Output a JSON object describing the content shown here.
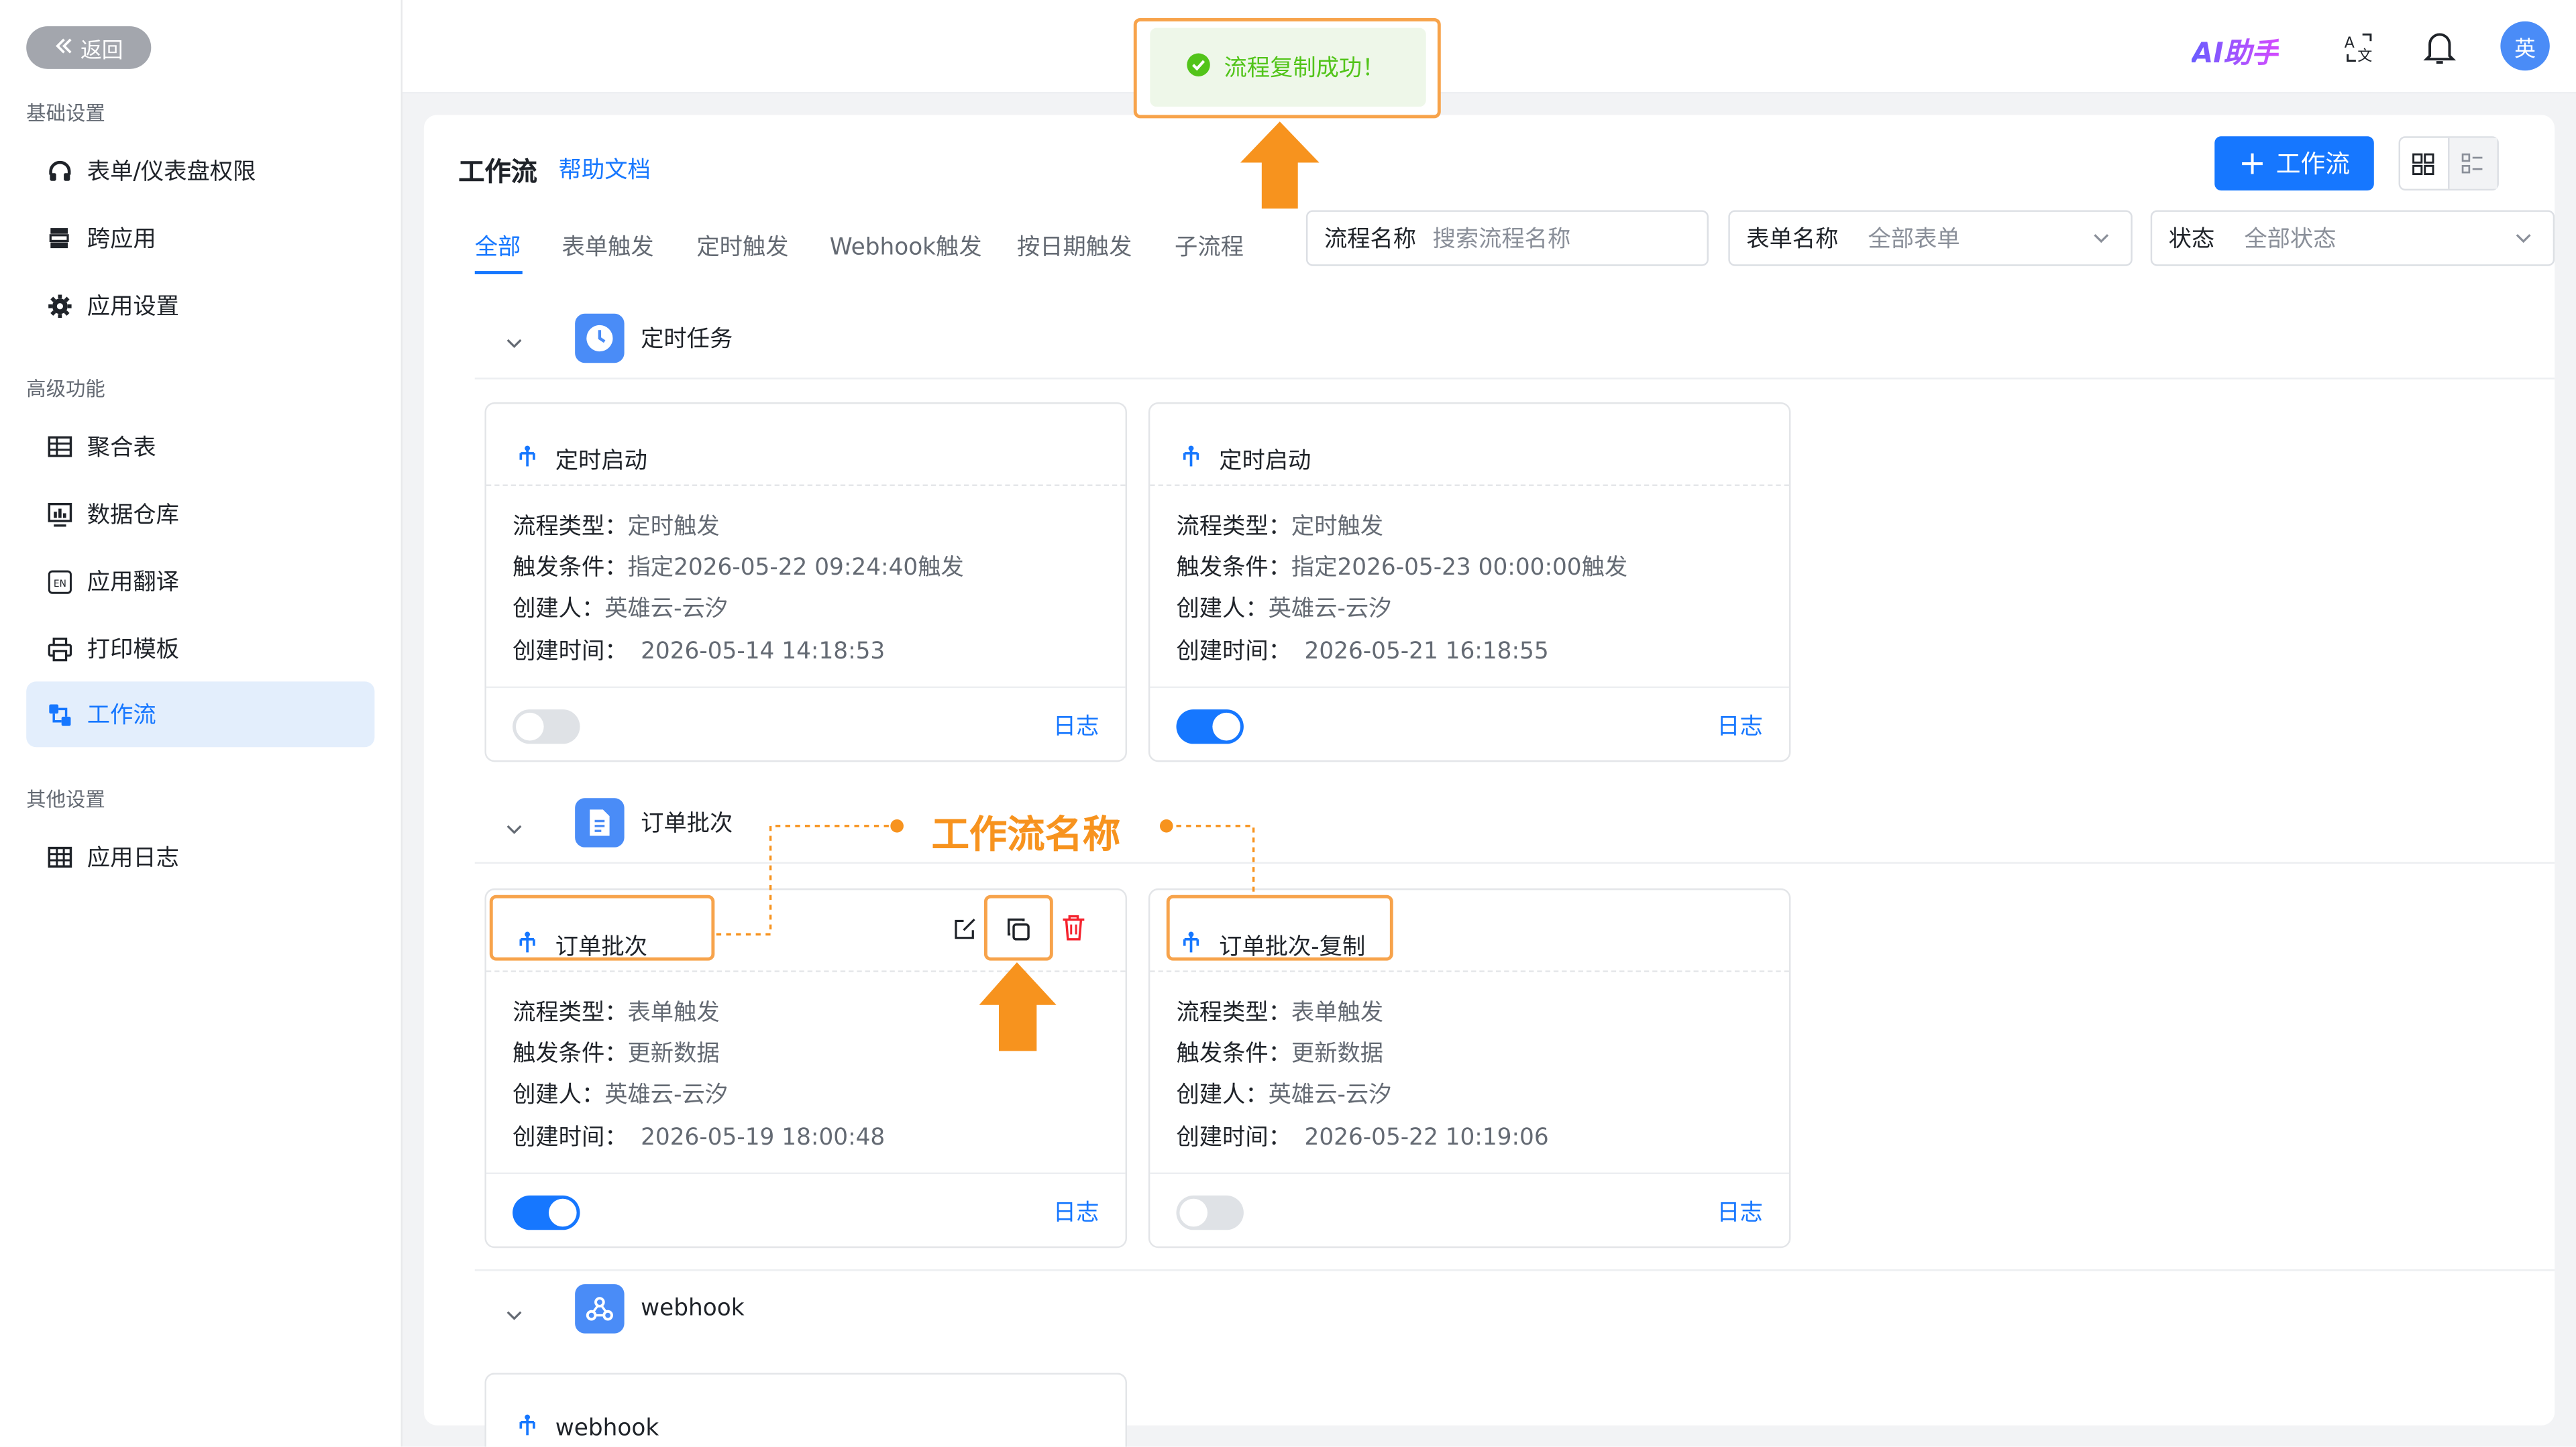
{
  "sidebar": {
    "back_label": "返回",
    "sections": [
      {
        "title": "基础设置",
        "items": [
          {
            "label": "表单/仪表盘权限",
            "icon": "headset-icon"
          },
          {
            "label": "跨应用",
            "icon": "stack-icon"
          },
          {
            "label": "应用设置",
            "icon": "gear-icon"
          }
        ]
      },
      {
        "title": "高级功能",
        "items": [
          {
            "label": "聚合表",
            "icon": "table-icon"
          },
          {
            "label": "数据仓库",
            "icon": "chart-icon"
          },
          {
            "label": "应用翻译",
            "icon": "translate-icon"
          },
          {
            "label": "打印模板",
            "icon": "printer-icon"
          },
          {
            "label": "工作流",
            "icon": "workflow-icon",
            "active": true
          }
        ]
      },
      {
        "title": "其他设置",
        "items": [
          {
            "label": "应用日志",
            "icon": "log-icon"
          }
        ]
      }
    ]
  },
  "header": {
    "ai_label": "AI助手",
    "avatar_text": "英"
  },
  "toast": {
    "message": "流程复制成功！"
  },
  "page": {
    "title": "工作流",
    "help_link": "帮助文档",
    "add_button": "工作流",
    "tabs": [
      "全部",
      "表单触发",
      "定时触发",
      "Webhook触发",
      "按日期触发",
      "子流程"
    ],
    "active_tab": 0,
    "filters": {
      "flow_name_label": "流程名称",
      "flow_name_placeholder": "搜索流程名称",
      "form_name_label": "表单名称",
      "form_name_value": "全部表单",
      "status_label": "状态",
      "status_value": "全部状态"
    }
  },
  "field_labels": {
    "type": "流程类型：",
    "trigger": "触发条件：",
    "creator": "创建人：",
    "created": "创建时间："
  },
  "log_label": "日志",
  "groups": [
    {
      "name": "定时任务",
      "icon": "clock-icon",
      "cards": [
        {
          "title": "定时启动",
          "type": "定时触发",
          "trigger": "指定2026-05-22 09:24:40触发",
          "creator": "英雄云-云汐",
          "created": "2026-05-14 14:18:53",
          "enabled": false
        },
        {
          "title": "定时启动",
          "type": "定时触发",
          "trigger": "指定2026-05-23 00:00:00触发",
          "creator": "英雄云-云汐",
          "created": "2026-05-21 16:18:55",
          "enabled": true
        }
      ]
    },
    {
      "name": "订单批次",
      "icon": "document-icon",
      "cards": [
        {
          "title": "订单批次",
          "type": "表单触发",
          "trigger": "更新数据",
          "creator": "英雄云-云汐",
          "created": "2026-05-19 18:00:48",
          "enabled": true
        },
        {
          "title": "订单批次-复制",
          "type": "表单触发",
          "trigger": "更新数据",
          "creator": "英雄云-云汐",
          "created": "2026-05-22 10:19:06",
          "enabled": false
        }
      ]
    },
    {
      "name": "webhook",
      "icon": "webhook-icon",
      "cards": [
        {
          "title": "webhook"
        }
      ]
    }
  ],
  "annotation": {
    "label": "工作流名称",
    "color": "#f7931e"
  },
  "colors": {
    "primary": "#1677ff",
    "highlight": "#f7a34b",
    "success": "#52c41a"
  }
}
